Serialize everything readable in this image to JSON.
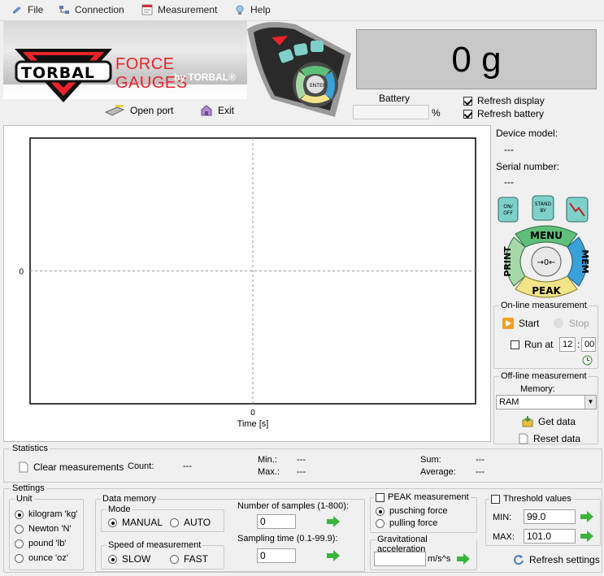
{
  "menu": {
    "items": [
      {
        "label": "File",
        "icon": "file-icon"
      },
      {
        "label": "Connection",
        "icon": "connection-icon"
      },
      {
        "label": "Measurement",
        "icon": "measurement-icon"
      },
      {
        "label": "Help",
        "icon": "help-bulb-icon"
      }
    ]
  },
  "header": {
    "logo_text": "TORBAL",
    "force_title": "FORCE GAUGES",
    "by_torbal": "by TORBAL®",
    "open_port": "Open port",
    "exit": "Exit",
    "display_value": "0 g",
    "battery_label": "Battery",
    "battery_unit": "%",
    "battery_value": "",
    "refresh_display": "Refresh display",
    "refresh_battery": "Refresh battery",
    "refresh_display_checked": true,
    "refresh_battery_checked": true
  },
  "remote_labels": {
    "mem": "MEM",
    "menu": "MENU",
    "print": "PRINT",
    "peak": "PEAK",
    "enter": "ENTER",
    "onoff": "ON/OFF",
    "standby": "STANDBY"
  },
  "chart_data": {
    "type": "line",
    "x": [],
    "y": [],
    "xticks": [
      "0"
    ],
    "yticks": [
      "0"
    ],
    "xlabel": "Time [s]",
    "ylabel": "",
    "grid": "dashed center crosshair"
  },
  "device": {
    "model_label": "Device model:",
    "model_value": "---",
    "serial_label": "Serial number:",
    "serial_value": "---",
    "btn_onoff": "ON/\nOFF",
    "btn_standby": "STAND\nBY",
    "btn_menu": "MENU",
    "btn_print": "PRINT",
    "btn_mem": "MEM",
    "btn_peak": "PEAK",
    "btn_zero": "→0←"
  },
  "online": {
    "title": "On-line measurement",
    "start": "Start",
    "stop": "Stop",
    "run_at": "Run at",
    "hour": "12",
    "minute": "00"
  },
  "offline": {
    "title": "Off-line measurement",
    "memory_label": "Memory:",
    "memory_value": "RAM",
    "get_data": "Get data",
    "reset_data": "Reset data"
  },
  "statistics": {
    "title": "Statistics",
    "clear": "Clear measurements",
    "count_label": "Count:",
    "count_value": "---",
    "min_label": "Min.:",
    "min_value": "---",
    "max_label": "Max.:",
    "max_value": "---",
    "sum_label": "Sum:",
    "sum_value": "---",
    "avg_label": "Average:",
    "avg_value": "---"
  },
  "settings": {
    "title": "Settings",
    "unit_title": "Unit",
    "units": [
      "kilogram 'kg'",
      "Newton 'N'",
      "pound 'lb'",
      "ounce 'oz'"
    ],
    "unit_selected": 0,
    "data_memory_title": "Data memory",
    "mode_title": "Mode",
    "mode_manual": "MANUAL",
    "mode_auto": "AUTO",
    "speed_title": "Speed of measurement",
    "speed_slow": "SLOW",
    "speed_fast": "FAST",
    "samples_label": "Number of samples (1-800):",
    "samples_value": "0",
    "sampling_label": "Sampling time (0.1-99.9):",
    "sampling_value": "0",
    "peak_title": "PEAK measurement",
    "peak_push": "pusching force",
    "peak_pull": "pulling force",
    "grav_title": "Gravitational acceleration",
    "grav_value": "",
    "grav_unit": "m/s^s",
    "threshold_title": "Threshold values",
    "min_label": "MIN:",
    "min_value": "99.0",
    "max_label": "MAX:",
    "max_value": "101.0",
    "refresh_settings": "Refresh settings"
  },
  "colors": {
    "brand_red": "#e8232a",
    "display_bg": "#c8c8c8",
    "remote_green": "#5fbf7a",
    "remote_blue": "#3aa0d8",
    "remote_yellow": "#f3e48a",
    "remote_teal": "#7fd0c8"
  }
}
